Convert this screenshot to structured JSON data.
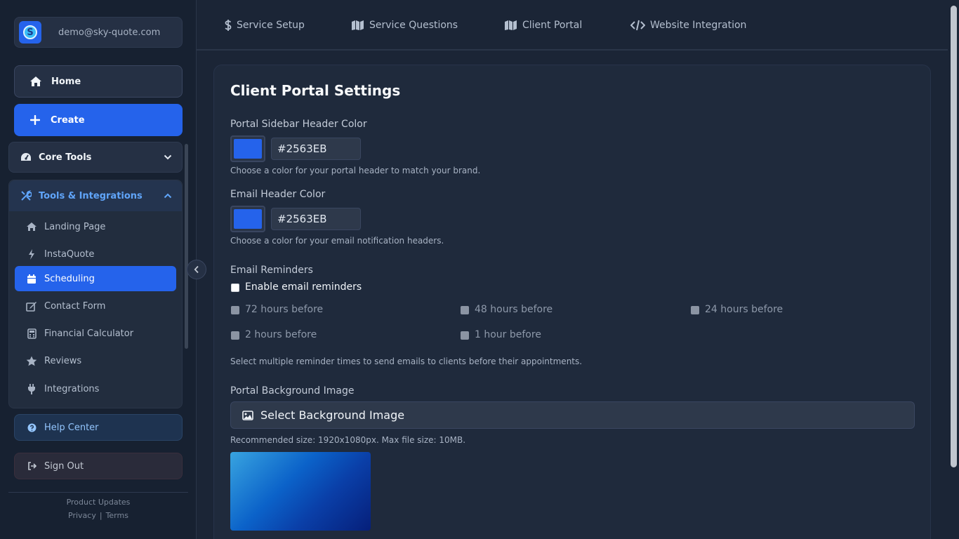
{
  "account": {
    "email": "demo@sky-quote.com",
    "logo_letter": "S"
  },
  "nav": {
    "home": "Home",
    "create": "Create"
  },
  "core_tools": {
    "label": "Core Tools"
  },
  "tools": {
    "label": "Tools & Integrations",
    "items": [
      {
        "label": "Landing Page",
        "icon": "home-icon"
      },
      {
        "label": "InstaQuote",
        "icon": "bolt-icon"
      },
      {
        "label": "Scheduling",
        "icon": "calendar-icon",
        "active": true
      },
      {
        "label": "Contact Form",
        "icon": "edit-icon"
      },
      {
        "label": "Financial Calculator",
        "icon": "calculator-icon"
      },
      {
        "label": "Reviews",
        "icon": "star-icon"
      },
      {
        "label": "Integrations",
        "icon": "plug-icon"
      }
    ]
  },
  "help": "Help Center",
  "signout": "Sign Out",
  "footer": {
    "updates": "Product Updates",
    "privacy": "Privacy",
    "separator": "|",
    "terms": "Terms"
  },
  "tabs": [
    {
      "label": "Service Setup",
      "icon": "dollar-icon"
    },
    {
      "label": "Service Questions",
      "icon": "map-icon"
    },
    {
      "label": "Client Portal",
      "icon": "map-icon"
    },
    {
      "label": "Website Integration",
      "icon": "code-icon"
    }
  ],
  "main": {
    "title": "Client Portal Settings",
    "sidebar_color": {
      "label": "Portal Sidebar Header Color",
      "value": "#2563EB",
      "helper": "Choose a color for your portal header to match your brand."
    },
    "email_color": {
      "label": "Email Header Color",
      "value": "#2563EB",
      "helper": "Choose a color for your email notification headers."
    },
    "reminders": {
      "label": "Email Reminders",
      "enable_label": "Enable email reminders",
      "options": [
        "72 hours before",
        "48 hours before",
        "24 hours before",
        "2 hours before",
        "1 hour before"
      ],
      "helper": "Select multiple reminder times to send emails to clients before their appointments."
    },
    "background": {
      "label": "Portal Background Image",
      "button": "Select Background Image",
      "helper": "Recommended size: 1920x1080px. Max file size: 10MB."
    }
  },
  "colors": {
    "accent": "#2563EB",
    "bg": "#1B2536",
    "panel": "#1F2A3C"
  }
}
